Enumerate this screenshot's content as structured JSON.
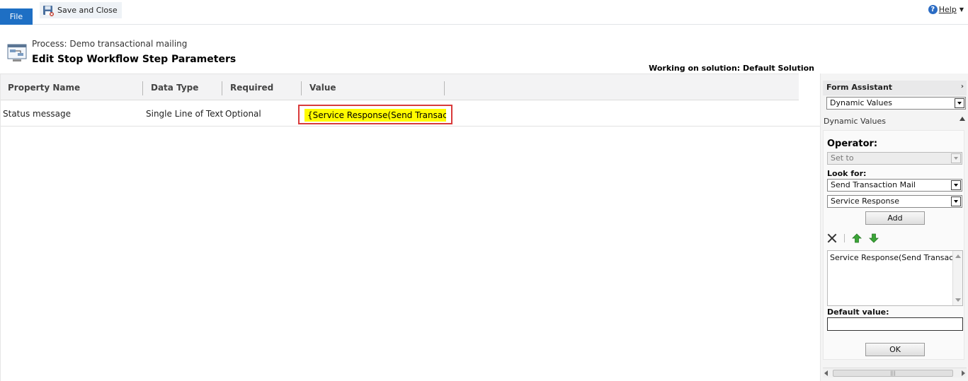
{
  "ribbon": {
    "file_label": "File",
    "save_close_label": "Save and Close",
    "help_label": "Help"
  },
  "header": {
    "process_label": "Process: Demo transactional mailing",
    "title": "Edit Stop Workflow Step Parameters",
    "solution_label": "Working on solution: Default Solution"
  },
  "grid": {
    "columns": [
      "Property Name",
      "Data Type",
      "Required",
      "Value"
    ],
    "rows": [
      {
        "property_name": "Status message",
        "data_type": "Single Line of Text",
        "required": "Optional",
        "value": "{Service Response(Send Transaction Mail)}"
      }
    ]
  },
  "form_assistant": {
    "title": "Form Assistant",
    "mode_select": "Dynamic Values",
    "section_title": "Dynamic Values",
    "operator_label": "Operator:",
    "operator_value": "Set to",
    "look_for_label": "Look for:",
    "look_for_entity": "Send Transaction Mail",
    "look_for_attribute": "Service Response",
    "add_label": "Add",
    "selected_values": "Service Response(Send Transaction Mail)",
    "default_value_label": "Default value:",
    "default_value": "",
    "ok_label": "OK"
  },
  "colors": {
    "file_button": "#1e6fc4",
    "highlight": "#fffb00",
    "focus_border": "#d93a3a",
    "arrow_green": "#3aa537"
  }
}
